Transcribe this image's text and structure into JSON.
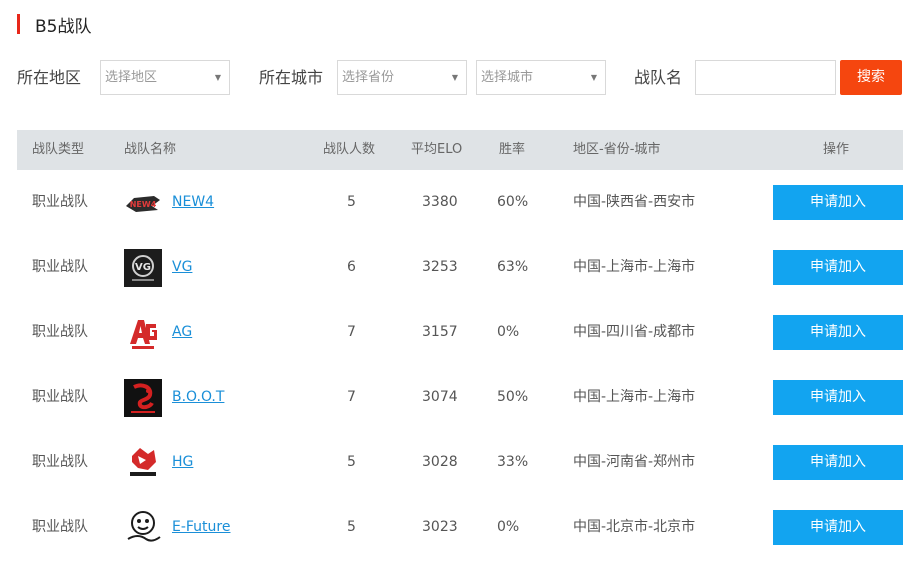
{
  "page": {
    "title": "B5战队"
  },
  "filters": {
    "region_label": "所在地区",
    "region_select": "选择地区",
    "city_label": "所在城市",
    "province_select": "选择省份",
    "city_select": "选择城市",
    "team_name_label": "战队名",
    "team_name_value": "",
    "search_button": "搜索"
  },
  "table": {
    "headers": [
      "战队类型",
      "战队名称",
      "战队人数",
      "平均ELO",
      "胜率",
      "地区-省份-城市",
      "操作"
    ],
    "rows": [
      {
        "type": "职业战队",
        "name": "NEW4",
        "logo": "new4-logo-icon",
        "members": "5",
        "elo": "3380",
        "win_rate": "60%",
        "location": "中国-陕西省-西安市",
        "action": "申请加入"
      },
      {
        "type": "职业战队",
        "name": "VG",
        "logo": "vg-logo-icon",
        "members": "6",
        "elo": "3253",
        "win_rate": "63%",
        "location": "中国-上海市-上海市",
        "action": "申请加入"
      },
      {
        "type": "职业战队",
        "name": "AG",
        "logo": "ag-logo-icon",
        "members": "7",
        "elo": "3157",
        "win_rate": "0%",
        "location": "中国-四川省-成都市",
        "action": "申请加入"
      },
      {
        "type": "职业战队",
        "name": "B.O.O.T",
        "logo": "boot-logo-icon",
        "members": "7",
        "elo": "3074",
        "win_rate": "50%",
        "location": "中国-上海市-上海市",
        "action": "申请加入"
      },
      {
        "type": "职业战队",
        "name": "HG",
        "logo": "hg-logo-icon",
        "members": "5",
        "elo": "3028",
        "win_rate": "33%",
        "location": "中国-河南省-郑州市",
        "action": "申请加入"
      },
      {
        "type": "职业战队",
        "name": "E-Future",
        "logo": "efuture-logo-icon",
        "members": "5",
        "elo": "3023",
        "win_rate": "0%",
        "location": "中国-北京市-北京市",
        "action": "申请加入"
      }
    ]
  },
  "colors": {
    "accent_red": "#e8281a",
    "search_button": "#f5460f",
    "apply_button": "#12a4f0",
    "link": "#1a8fd8",
    "header_bg": "#dfe3e6"
  }
}
